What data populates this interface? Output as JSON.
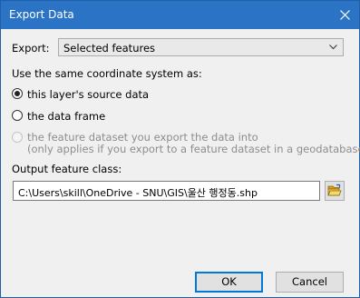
{
  "window": {
    "title": "Export Data"
  },
  "export": {
    "label": "Export:",
    "selected": "Selected features"
  },
  "coordinate": {
    "heading": "Use the same coordinate system as:",
    "options": [
      {
        "label": "this layer's source data",
        "selected": true,
        "enabled": true
      },
      {
        "label": "the data frame",
        "selected": false,
        "enabled": true
      },
      {
        "label": "the feature dataset you export the data into",
        "note": "(only applies if you export to a feature dataset in a geodatabase)",
        "selected": false,
        "enabled": false
      }
    ]
  },
  "output": {
    "label": "Output feature class:",
    "value": "C:\\Users\\skill\\OneDrive - SNU\\GIS\\울산 행정동.shp"
  },
  "buttons": {
    "ok": "OK",
    "cancel": "Cancel"
  },
  "icons": {
    "close": "close-icon",
    "dropdown": "chevron-down-icon",
    "browse": "open-folder-icon"
  },
  "colors": {
    "titlebar": "#2b73c4",
    "default_button_border": "#0078d7"
  }
}
